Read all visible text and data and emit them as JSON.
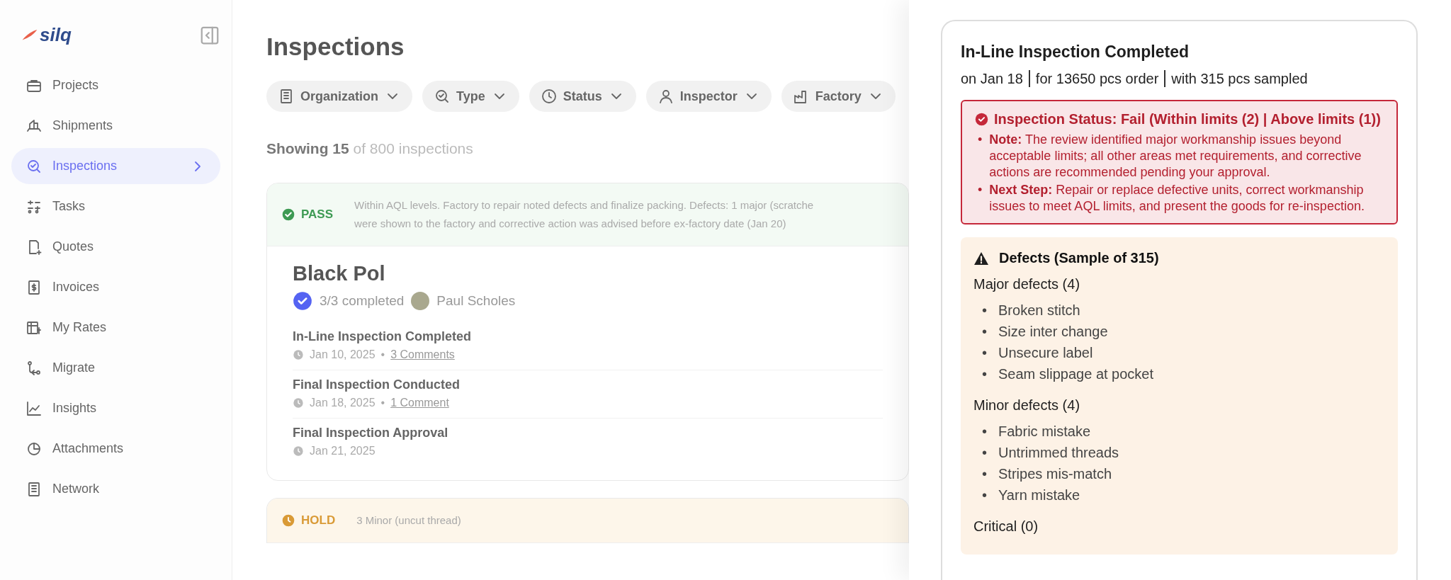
{
  "sidebar": {
    "logo": "silq",
    "items": [
      {
        "label": "Projects",
        "selected": false
      },
      {
        "label": "Shipments",
        "selected": false
      },
      {
        "label": "Inspections",
        "selected": true
      },
      {
        "label": "Tasks",
        "selected": false
      },
      {
        "label": "Quotes",
        "selected": false
      },
      {
        "label": "Invoices",
        "selected": false
      },
      {
        "label": "My Rates",
        "selected": false
      },
      {
        "label": "Migrate",
        "selected": false
      },
      {
        "label": "Insights",
        "selected": false
      },
      {
        "label": "Attachments",
        "selected": false
      },
      {
        "label": "Network",
        "selected": false
      }
    ]
  },
  "main": {
    "title": "Inspections",
    "filters": [
      {
        "label": "Organization"
      },
      {
        "label": "Type"
      },
      {
        "label": "Status"
      },
      {
        "label": "Inspector"
      },
      {
        "label": "Factory"
      }
    ],
    "showing": "**Showing 15** of 800 inspections",
    "cards": [
      {
        "kind": "pass",
        "status": "PASS",
        "note": [
          "Within AQL levels. Factory to repair noted defects and finalize packing. Defects: 1 major (scratche",
          "were shown to the factory and corrective action was advised before ex-factory date (Jan 20)"
        ],
        "title": "Black Pol",
        "progress": "3/3 completed",
        "inspector": "Paul Scholes",
        "separator": "•",
        "steps": [
          {
            "title": "In-Line Inspection Completed",
            "date": "Jan 10, 2025",
            "comments": "3 Comments"
          },
          {
            "title": "Final Inspection Conducted",
            "date": "Jan 18, 2025",
            "comments": "1 Comment"
          },
          {
            "title": "Final Inspection Approval",
            "date": "Jan 21, 2025"
          }
        ]
      },
      {
        "kind": "hold",
        "status": "HOLD",
        "note": [
          "3 Minor (uncut thread)"
        ]
      }
    ]
  },
  "panel": {
    "title": "In-Line Inspection Completed",
    "meta": [
      "on Jan 18",
      "for 13650 pcs order",
      "with 315 pcs sampled"
    ],
    "status": {
      "heading": "Inspection Status: Fail (Within limits (2) | Above limits (1))",
      "marker": "•",
      "bullets": [
        "**Note:** The review identified major workmanship issues beyond acceptable limits; all other areas met requirements, and corrective actions are recommended pending your approval.",
        "**Next Step:** Repair or replace defective units, correct workmanship issues to meet AQL limits, and present the goods for re-inspection."
      ]
    },
    "defects": {
      "title": "Defects (Sample of 315)",
      "groups": [
        {
          "heading": "Major defects (4)",
          "items": [
            "Broken stitch",
            "Size inter change",
            "Unsecure label",
            "Seam slippage at pocket"
          ]
        },
        {
          "heading": "Minor defects (4)",
          "items": [
            "Fabric mistake",
            "Untrimmed threads",
            "Stripes mis-match",
            "Yarn mistake"
          ]
        },
        {
          "heading": "Critical (0)"
        }
      ],
      "marker": "•"
    }
  }
}
